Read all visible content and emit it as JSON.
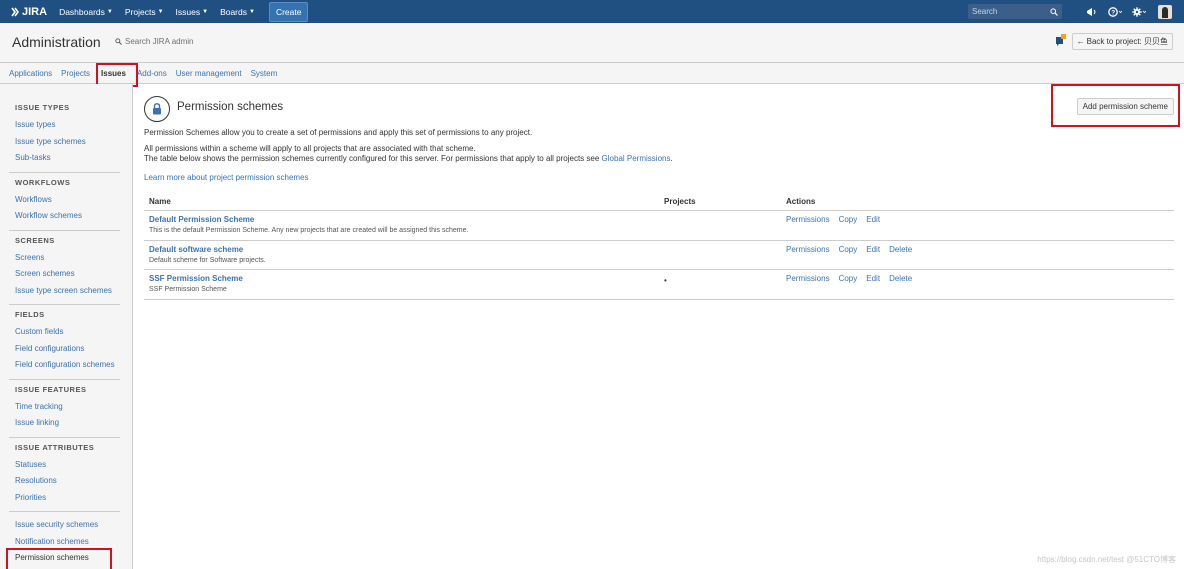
{
  "topnav": {
    "logo": "JIRA",
    "items": [
      {
        "label": "Dashboards"
      },
      {
        "label": "Projects"
      },
      {
        "label": "Issues"
      },
      {
        "label": "Boards"
      }
    ],
    "create_label": "Create",
    "search_placeholder": "Search"
  },
  "admin": {
    "title": "Administration",
    "search_label": "Search JIRA admin",
    "back_label": "Back to project: 贝贝鱼"
  },
  "tabs": [
    {
      "label": "Applications"
    },
    {
      "label": "Projects"
    },
    {
      "label": "Issues",
      "active": true
    },
    {
      "label": "Add-ons"
    },
    {
      "label": "User management"
    },
    {
      "label": "System"
    }
  ],
  "sidebar": {
    "groups": [
      {
        "heading": "ISSUE TYPES",
        "items": [
          "Issue types",
          "Issue type schemes",
          "Sub-tasks"
        ]
      },
      {
        "heading": "WORKFLOWS",
        "items": [
          "Workflows",
          "Workflow schemes"
        ]
      },
      {
        "heading": "SCREENS",
        "items": [
          "Screens",
          "Screen schemes",
          "Issue type screen schemes"
        ]
      },
      {
        "heading": "FIELDS",
        "items": [
          "Custom fields",
          "Field configurations",
          "Field configuration schemes"
        ]
      },
      {
        "heading": "ISSUE FEATURES",
        "items": [
          "Time tracking",
          "Issue linking"
        ]
      },
      {
        "heading": "ISSUE ATTRIBUTES",
        "items": [
          "Statuses",
          "Resolutions",
          "Priorities"
        ]
      }
    ],
    "last_items": [
      "Issue security schemes",
      "Notification schemes",
      "Permission schemes"
    ]
  },
  "main": {
    "title": "Permission schemes",
    "add_button": "Add permission scheme",
    "desc1": "Permission Schemes allow you to create a set of permissions and apply this set of permissions to any project.",
    "desc2": "All permissions within a scheme will apply to all projects that are associated with that scheme.",
    "desc3_prefix": "The table below shows the permission schemes currently configured for this server. For permissions that apply to all projects see ",
    "desc3_link": "Global Permissions",
    "desc3_suffix": ".",
    "learn_more": "Learn more about project permission schemes",
    "table": {
      "headers": {
        "name": "Name",
        "projects": "Projects",
        "actions": "Actions"
      },
      "rows": [
        {
          "name": "Default Permission Scheme",
          "desc": "This is the default Permission Scheme. Any new projects that are created will be assigned this scheme.",
          "projects": "",
          "actions": [
            "Permissions",
            "Copy",
            "Edit"
          ]
        },
        {
          "name": "Default software scheme",
          "desc": "Default scheme for Software projects.",
          "projects": "",
          "actions": [
            "Permissions",
            "Copy",
            "Edit",
            "Delete"
          ]
        },
        {
          "name": "SSF Permission Scheme",
          "desc": "SSF Permission Scheme",
          "projects": "•",
          "actions": [
            "Permissions",
            "Copy",
            "Edit",
            "Delete"
          ]
        }
      ]
    }
  },
  "watermark": "https://blog.csdn.net/test   @51CTO博客",
  "colors": {
    "topbar": "#205081",
    "link": "#3b73af",
    "highlight": "#d0111f"
  }
}
